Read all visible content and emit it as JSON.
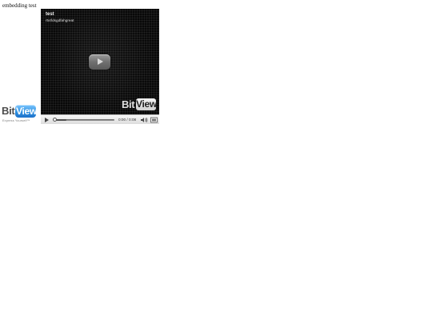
{
  "page": {
    "text": "embedding test"
  },
  "logo": {
    "bit": "Bit",
    "view": "View",
    "slogan": "Express Yourself™"
  },
  "player": {
    "title": "test",
    "video_id": "r54fdsgdfahgreat",
    "time": "0:00 / 0:08",
    "watermark_bit": "Bit",
    "watermark_view": "View",
    "progress_fraction": 0.2,
    "colors": {
      "accent": "#2d8fe0",
      "control_bar": "#e5e5e5",
      "video_background": "#050505"
    },
    "icons": {
      "play": "play-icon",
      "volume": "volume-icon",
      "fullscreen": "fullscreen-icon"
    }
  }
}
